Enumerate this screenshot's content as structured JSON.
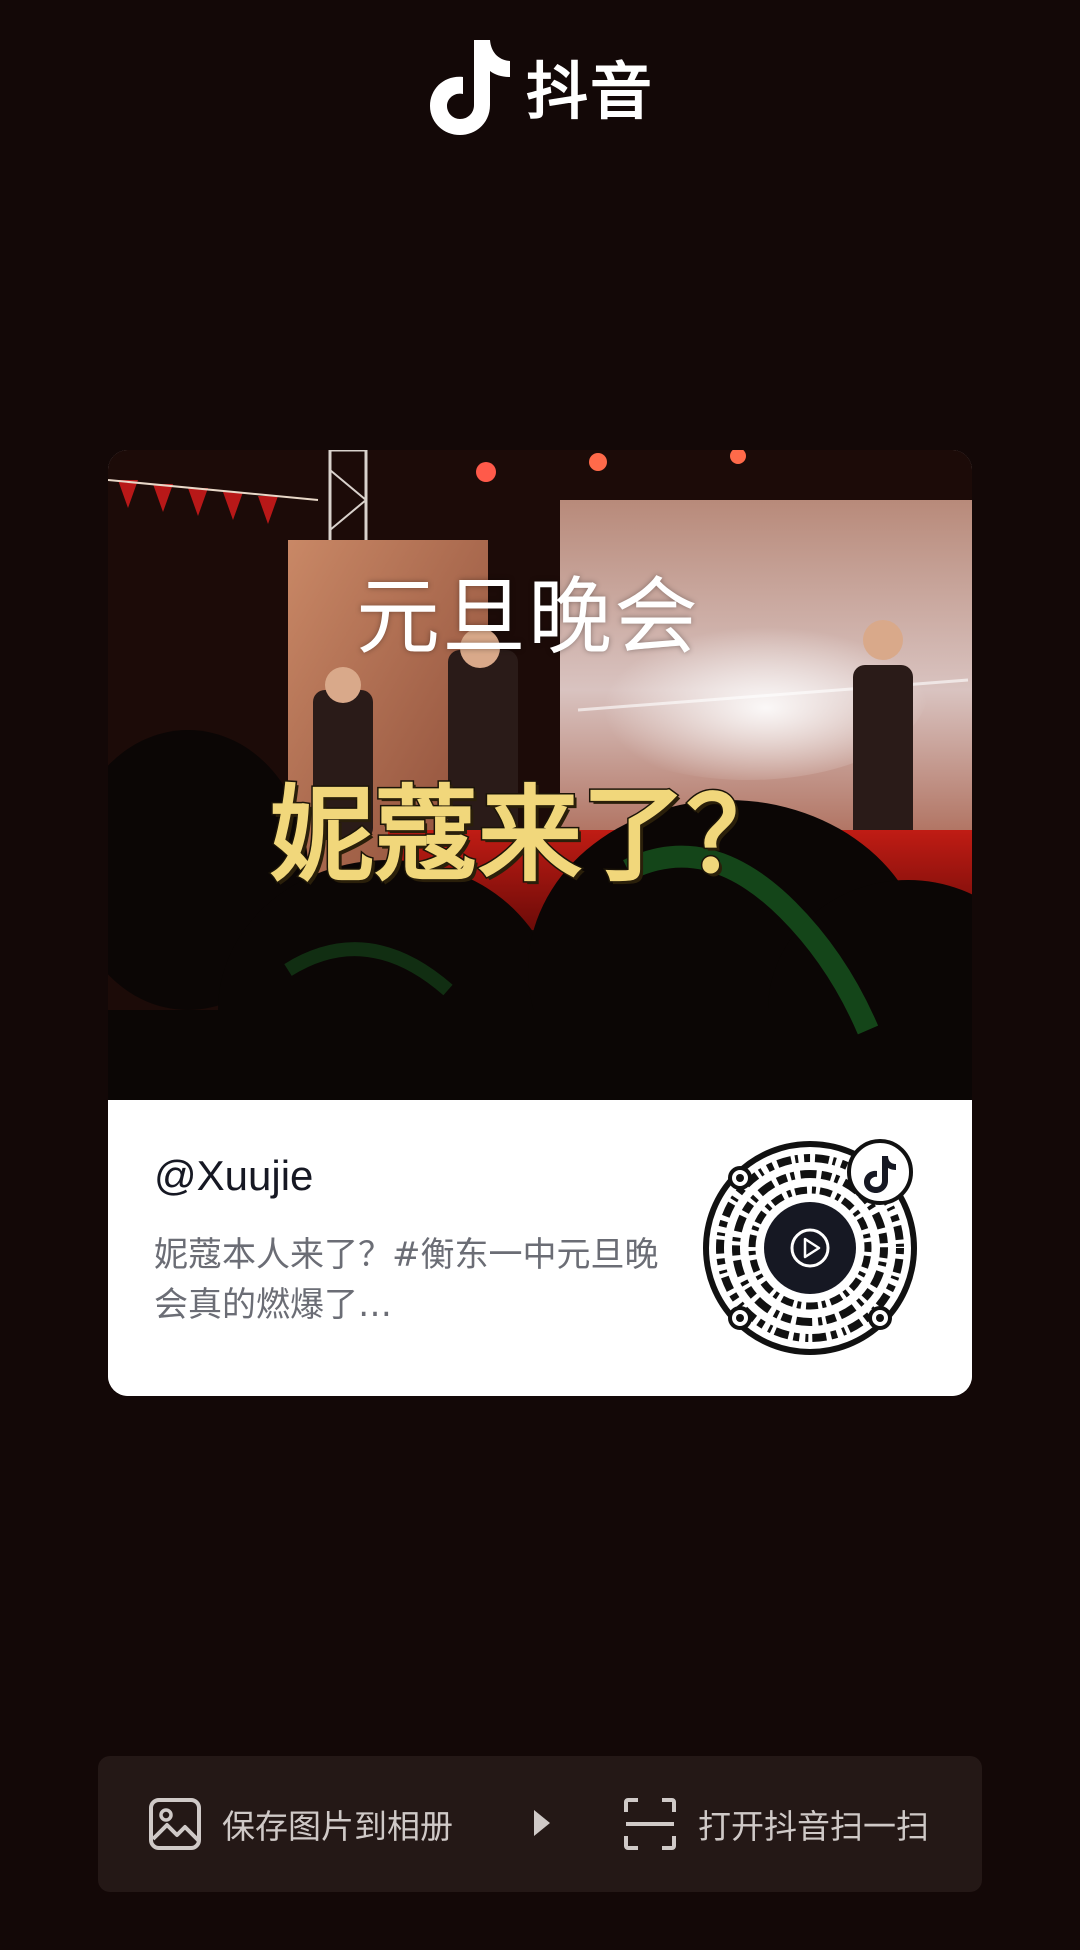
{
  "header": {
    "app_name": "抖音"
  },
  "card": {
    "cover": {
      "caption_line1": "元旦晚会",
      "caption_line2": "妮蔻来了？"
    },
    "author": "@Xuujie",
    "description": "妮蔻本人来了？#衡东一中元旦晚会真的燃爆了…"
  },
  "actions": {
    "save_label": "保存图片到相册",
    "scan_label": "打开抖音扫一扫"
  },
  "colors": {
    "background": "#130807",
    "card": "#ffffff",
    "action_bar": "#241816",
    "caption_gold": "#f1d77b"
  },
  "icons": {
    "logo": "douyin-logo-icon",
    "save": "image-icon",
    "arrow": "play-arrow-icon",
    "scan": "scan-icon",
    "qr_center": "play-circle-icon",
    "qr_badge": "douyin-badge-icon"
  }
}
